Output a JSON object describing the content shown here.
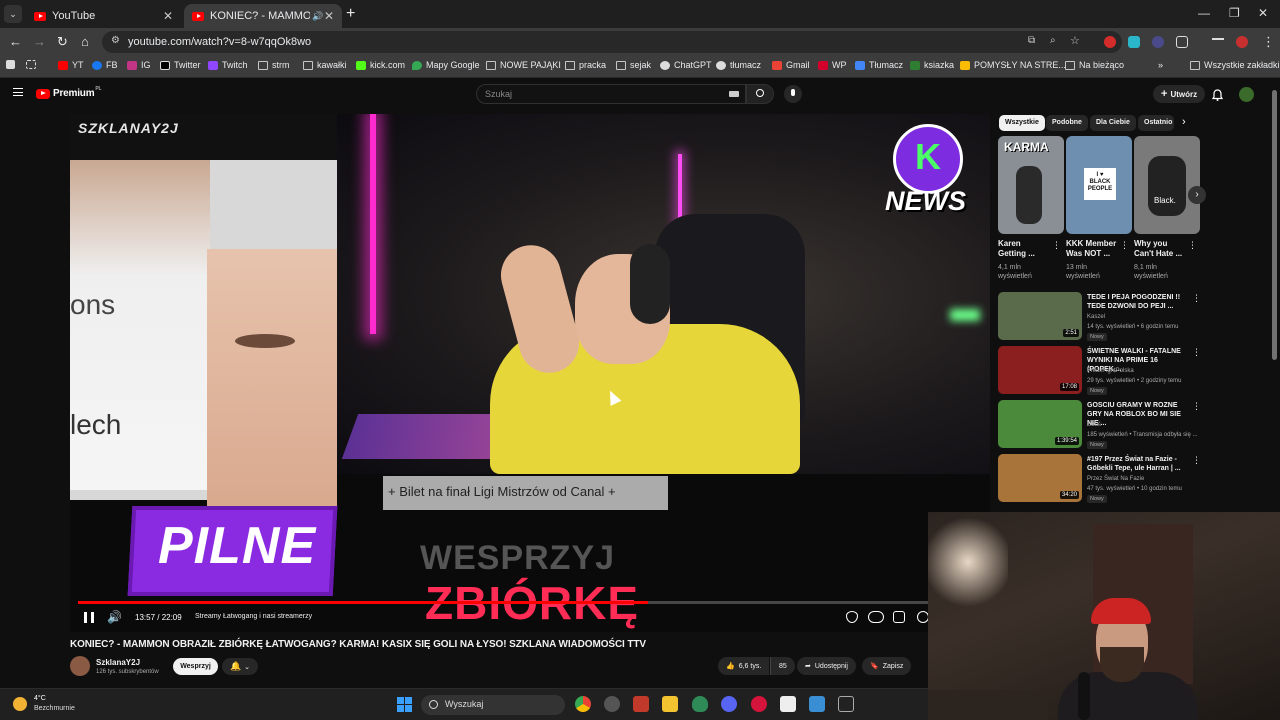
{
  "browser": {
    "tabs": [
      {
        "title": "YouTube",
        "active": false
      },
      {
        "title": "KONIEC? - MAMMON OBRA",
        "active": true
      }
    ],
    "url": "youtube.com/watch?v=8-w7qqOk8wo",
    "bookmarks": [
      "YT",
      "FB",
      "IG",
      "Twitter",
      "Twitch",
      "strm",
      "kawałki",
      "kick.com",
      "Mapy Google",
      "NOWE PAJĄKI",
      "pracka",
      "sejak",
      "ChatGPT",
      "tłumacz",
      "Gmail",
      "WP",
      "Tłumacz",
      "ksiazka",
      "POMYSŁY NA STRE...",
      "Na bieżąco"
    ],
    "bookmarks_all": "Wszystkie zakładki"
  },
  "youtube": {
    "logo_text": "Premium",
    "logo_region": "PL",
    "search_placeholder": "Szukaj",
    "create_label": "Utwórz"
  },
  "player": {
    "watermark": "SZKLANAY2J",
    "news_logo": "NEWS",
    "left_text_1": "ons",
    "left_text_2": "lech",
    "caption_line": "+ Bilet na finał Ligi Mistrzów od Canal +",
    "overlay_support": "WESPRZYJ",
    "overlay_collect": "ZBIÓRKĘ",
    "pilne": "PILNE",
    "time": "13:57 / 22:09",
    "chapter": "Streamy Łatwogang i nasi streamerzy",
    "progress": 0.63
  },
  "video": {
    "title": "KONIEC? - MAMMON OBRAZIŁ ZBIÓRKĘ ŁATWOGANG? KARMA! KASIX SIĘ GOLI NA ŁYSO! SZKLANA WIADOMOŚCI TTV",
    "channel": "SzklanaY2J",
    "subscribers": "126 tys. subskrybentów",
    "support_label": "Wesprzyj",
    "likes": "6,6 tys.",
    "dislikes": "85",
    "share_label": "Udostępnij",
    "save_label": "Zapisz"
  },
  "sidebar": {
    "chips": [
      "Wszystkie",
      "Podobne",
      "Dla Ciebie",
      "Ostatnio"
    ],
    "shorts": [
      {
        "title": "Karen Getting ...",
        "views": "4,1 mln wyświetleń",
        "thumb_text": "KARMA",
        "color": "#8a8f95"
      },
      {
        "title": "KKK Member Was NOT ...",
        "views": "13 mln wyświetleń",
        "thumb_text": "I ♥ BLACK PEOPLE",
        "color": "#6f8fb0"
      },
      {
        "title": "Why you Can't Hate ...",
        "views": "8,1 mln wyświetleń",
        "thumb_text": "Black.",
        "color": "#7a7a7a"
      }
    ],
    "recommendations": [
      {
        "title": "TEDE I PEJA POGODZENI !! TEDE DZWONI DO PEJI ...",
        "channel": "Kaszel",
        "meta": "14 tys. wyświetleń • 6 godzin temu",
        "badge": "Nowy",
        "duration": "2:51",
        "color": "#5a6b4c"
      },
      {
        "title": "ŚWIETNE WALKI - FATALNE WYNIKI NA PRIME 16 (POPEK,...",
        "channel": "FreakFightPolska",
        "meta": "29 tys. wyświetleń • 2 godziny temu",
        "badge": "Nowy",
        "duration": "17:08",
        "color": "#8b1f1f"
      },
      {
        "title": "GOSCIU GRAMY W ROZNE GRY NA ROBLOX BO MI SIE NIE ...",
        "channel": "zibuś",
        "meta": "185 wyświetleń • Transmisja odbyła się ...",
        "badge": "Nowy",
        "duration": "1:39:54",
        "color": "#4a8a3a"
      },
      {
        "title": "#197 Przez Świat na Fazie - Göbekli Tepe, ule Harran | ...",
        "channel": "Przez Świat Na Fazie",
        "meta": "47 tys. wyświetleń • 10 godzin temu",
        "badge": "Nowy",
        "duration": "34:20",
        "color": "#a8743a"
      }
    ]
  },
  "taskbar": {
    "temperature": "4°C",
    "weather": "Bezchmurnie",
    "search_label": "Wyszukaj"
  }
}
